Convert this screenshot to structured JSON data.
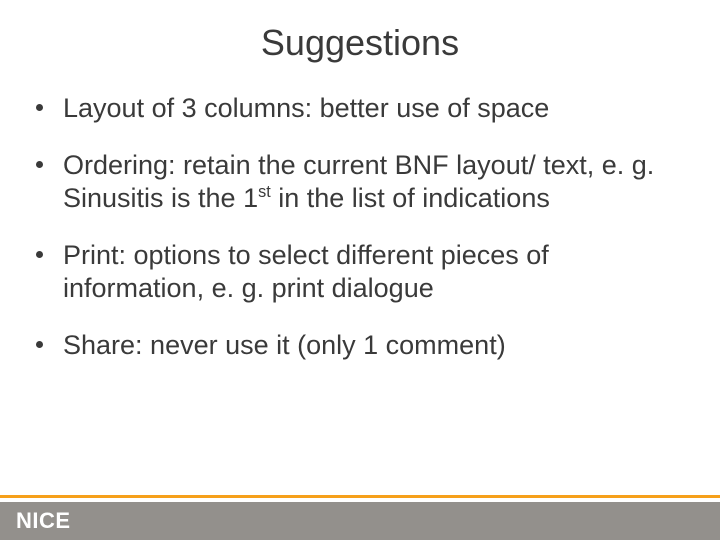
{
  "title": "Suggestions",
  "bullets": [
    {
      "pre": "Layout of 3 columns: better use of space",
      "sup": "",
      "post": ""
    },
    {
      "pre": "Ordering: retain the current BNF layout/ text, e. g. Sinusitis is the 1",
      "sup": "st",
      "post": " in the list of indications"
    },
    {
      "pre": "Print: options to select different pieces of information, e. g. print dialogue",
      "sup": "",
      "post": ""
    },
    {
      "pre": "Share: never use it (only 1 comment)",
      "sup": "",
      "post": ""
    }
  ],
  "logo": "NICE",
  "colors": {
    "accent": "#f6a01a",
    "footer": "#93908c"
  }
}
